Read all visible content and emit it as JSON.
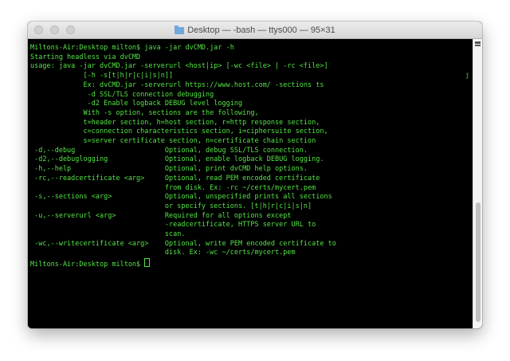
{
  "window": {
    "title": "Desktop — -bash — ttys000 — 95×31",
    "folder_icon": "folder-icon"
  },
  "terminal": {
    "lines": [
      "Miltons-Air:Desktop milton$ java -jar dvCMD.jar -h",
      "Starting headless via dvCMD",
      "usage: java -jar dvCMD.jar -serverurl <host|ip> [-wc <file> | -rc <file>]",
      "             [-h -s[t|h|r|c|i|s|n]]",
      "             Ex: dvCMD.jar -serverurl https://www.host.com/ -sections ts",
      "              -d SSL/TLS connection debugging",
      "              -d2 Enable logback DEBUG level logging",
      "             With -s option, sections are the following,",
      "             t=header section, h=host section, r=http response section,",
      "             c=connection characteristics section, i=ciphersuite section,",
      "             s=server certificate section, n=certificate chain section",
      " -d,--debug                      Optional, debug SSL/TLS connection.",
      " -d2,--debuglogging              Optional, enable logback DEBUG logging.",
      " -h,--help                       Optional, print dvCMD help options.",
      " -rc,--readcertificate <arg>     Optional, read PEM encoded certificate",
      "                                 from disk. Ex: -rc ~/certs/mycert.pem",
      " -s,--sections <arg>             Optional, unspecified prints all sections",
      "                                 or specify sections. [t|h|r|c|i|s|n]",
      " -u,--serverurl <arg>            Required for all options except",
      "                                 -readcertificate, HTTPS server URL to",
      "                                 scan.",
      " -wc,--writecertificate <arg>    Optional, write PEM encoded certificate to",
      "                                 disk. Ex: -wc ~/certs/mycert.pem"
    ],
    "prompt": "Miltons-Air:Desktop milton$ ",
    "right_mark": "j"
  },
  "colors": {
    "text": "#54e346",
    "background": "#000000",
    "titlebar": "#e0e0e0"
  },
  "icons": {
    "close": "close-button",
    "minimize": "minimize-button",
    "zoom": "zoom-button",
    "scrollbar_menu": "menu-icon"
  }
}
